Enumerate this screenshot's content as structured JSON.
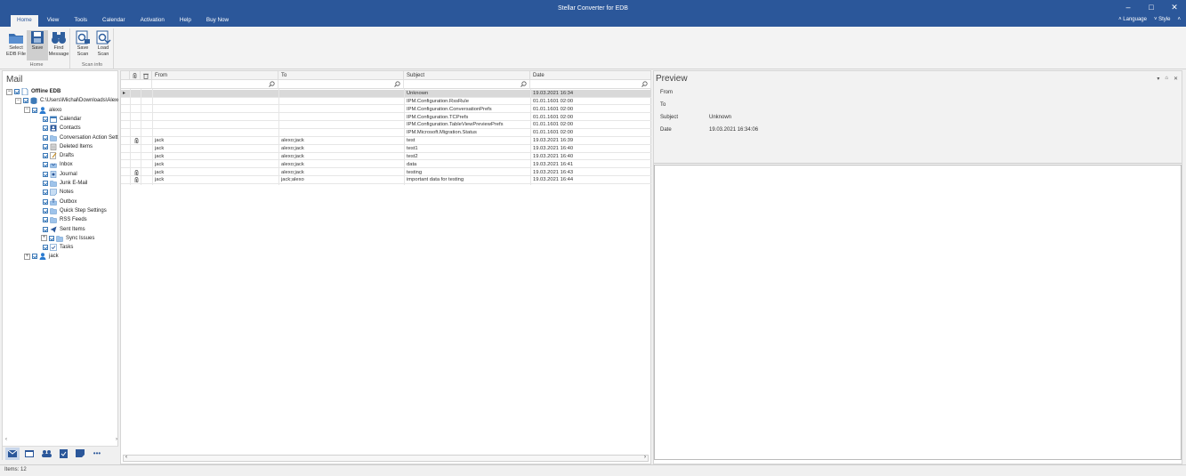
{
  "window": {
    "title": "Stellar Converter for EDB",
    "controls": [
      "–",
      "□",
      "✕"
    ]
  },
  "menu": {
    "tabs": [
      "Home",
      "View",
      "Tools",
      "Calendar",
      "Activation",
      "Help",
      "Buy Now"
    ],
    "active_tab": "Home",
    "language_label": "˄ Language",
    "style_label": "˅ Style",
    "collapse_label": "˄"
  },
  "ribbon": {
    "groups": [
      {
        "label": "Home",
        "buttons": [
          {
            "line1": "Select",
            "line2": "EDB File",
            "icon": "folder-open-icon"
          },
          {
            "line1": "Save",
            "line2": "",
            "icon": "save-disk-icon"
          },
          {
            "line1": "Find",
            "line2": "Message",
            "icon": "binoculars-icon"
          }
        ]
      },
      {
        "label": "Scan info",
        "buttons": [
          {
            "line1": "Save",
            "line2": "Scan",
            "icon": "save-scan-icon"
          },
          {
            "line1": "Load",
            "line2": "Scan",
            "icon": "load-scan-icon"
          }
        ]
      }
    ]
  },
  "left_pane": {
    "title": "Mail",
    "tree": [
      {
        "label": "Offline EDB",
        "level": 0,
        "exp": "−",
        "icon": "document-icon",
        "bold": true
      },
      {
        "label": "C:\\Users\\Michał\\Downloads\\Alexo",
        "level": 1,
        "exp": "−",
        "icon": "database-icon"
      },
      {
        "label": "alexo",
        "level": 2,
        "exp": "−",
        "icon": "user-icon"
      },
      {
        "label": "Calendar",
        "level": 3,
        "icon": "calendar-icon"
      },
      {
        "label": "Contacts",
        "level": 3,
        "icon": "contacts-icon"
      },
      {
        "label": "Conversation Action Settings",
        "level": 3,
        "icon": "folder-icon"
      },
      {
        "label": "Deleted Items",
        "level": 3,
        "icon": "trash-icon"
      },
      {
        "label": "Drafts",
        "level": 3,
        "icon": "drafts-icon"
      },
      {
        "label": "Inbox",
        "level": 3,
        "icon": "inbox-icon"
      },
      {
        "label": "Journal",
        "level": 3,
        "icon": "journal-icon"
      },
      {
        "label": "Junk E-Mail",
        "level": 3,
        "icon": "junk-icon"
      },
      {
        "label": "Notes",
        "level": 3,
        "icon": "notes-icon"
      },
      {
        "label": "Outbox",
        "level": 3,
        "icon": "outbox-icon"
      },
      {
        "label": "Quick Step Settings",
        "level": 3,
        "icon": "folder-icon"
      },
      {
        "label": "RSS Feeds",
        "level": 3,
        "icon": "rss-icon"
      },
      {
        "label": "Sent Items",
        "level": 3,
        "icon": "sent-icon"
      },
      {
        "label": "Sync Issues",
        "level": 3,
        "exp": "+",
        "icon": "folder-icon"
      },
      {
        "label": "Tasks",
        "level": 3,
        "icon": "tasks-icon"
      },
      {
        "label": "jack",
        "level": 2,
        "exp": "+",
        "icon": "user-icon"
      }
    ],
    "scroll_left": "‹",
    "scroll_right": "›",
    "nav_icons": [
      "mail-icon",
      "calendar-nav-icon",
      "people-icon",
      "tasks-nav-icon",
      "notes-nav-icon",
      "more-icon"
    ],
    "more_label": "•••"
  },
  "grid": {
    "columns": [
      {
        "key": "attach",
        "label": "",
        "icon": "paperclip-icon"
      },
      {
        "key": "del",
        "label": "",
        "icon": "trash-icon"
      },
      {
        "key": "from",
        "label": "From"
      },
      {
        "key": "to",
        "label": "To"
      },
      {
        "key": "subject",
        "label": "Subject"
      },
      {
        "key": "date",
        "label": "Date"
      }
    ],
    "rows": [
      {
        "attach": false,
        "from": "",
        "to": "",
        "subject": "Unknown",
        "date": "19.03.2021 16:34",
        "selected": true
      },
      {
        "attach": false,
        "from": "",
        "to": "",
        "subject": "IPM.Configuration.RssRule",
        "date": "01.01.1601 02:00"
      },
      {
        "attach": false,
        "from": "",
        "to": "",
        "subject": "IPM.Configuration.ConversationPrefs",
        "date": "01.01.1601 02:00"
      },
      {
        "attach": false,
        "from": "",
        "to": "",
        "subject": "IPM.Configuration.TCPrefs",
        "date": "01.01.1601 02:00"
      },
      {
        "attach": false,
        "from": "",
        "to": "",
        "subject": "IPM.Configuration.TableViewPreviewPrefs",
        "date": "01.01.1601 02:00"
      },
      {
        "attach": false,
        "from": "",
        "to": "",
        "subject": "IPM.Microsoft.Migration.Status",
        "date": "01.01.1601 02:00"
      },
      {
        "attach": true,
        "from": "jack",
        "to": "alexo;jack",
        "subject": "test",
        "date": "19.03.2021 16:39"
      },
      {
        "attach": false,
        "from": "jack",
        "to": "alexo;jack",
        "subject": "test1",
        "date": "19.03.2021 16:40"
      },
      {
        "attach": false,
        "from": "jack",
        "to": "alexo;jack",
        "subject": "test2",
        "date": "19.03.2021 16:40"
      },
      {
        "attach": false,
        "from": "jack",
        "to": "alexo;jack",
        "subject": "data",
        "date": "19.03.2021 16:41"
      },
      {
        "attach": true,
        "from": "jack",
        "to": "alexo;jack",
        "subject": "testing",
        "date": "19.03.2021 16:43"
      },
      {
        "attach": true,
        "from": "jack",
        "to": "jack;alexo",
        "subject": "important data for testing",
        "date": "19.03.2021 16:44"
      }
    ],
    "row_pointer": "▸",
    "scroll_left": "‹",
    "scroll_right": "›"
  },
  "preview": {
    "title": "Preview",
    "controls": [
      "▾",
      "⌂",
      "✕"
    ],
    "fields": [
      {
        "label": "From",
        "value": ""
      },
      {
        "label": "To",
        "value": ""
      },
      {
        "label": "Subject",
        "value": "Unknown"
      },
      {
        "label": "Date",
        "value": "19.03.2021 16:34:06"
      }
    ]
  },
  "status": {
    "text": "Items: 12"
  },
  "colors": {
    "title_bar": "#2b579a",
    "accent": "#3d7ab8",
    "selected_row": "#d9d9d9"
  }
}
